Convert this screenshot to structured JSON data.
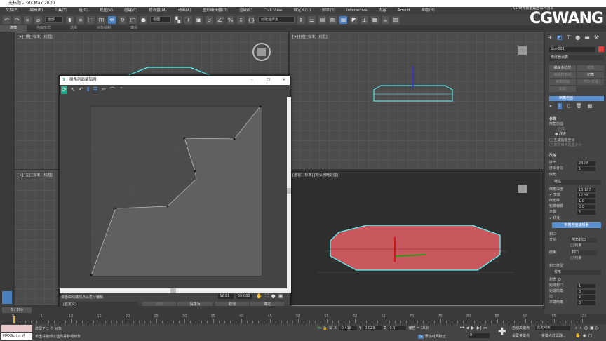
{
  "app": {
    "title": "无标题 - 3ds Max 2020"
  },
  "menu": [
    "文件(F)",
    "编辑(E)",
    "工具(T)",
    "组(G)",
    "视图(V)",
    "创建(C)",
    "修改器(M)",
    "动画(A)",
    "图形编辑器(D)",
    "渲染(R)",
    "Civil View",
    "自定义(U)",
    "脚本(S)",
    "Interactive",
    "内容",
    "Arnold",
    "帮助(H)"
  ],
  "toolbar": {
    "selection_filter": "全部",
    "ref_coord": "视图",
    "named_selection": "创建选择集"
  },
  "ribbon": [
    "建模",
    "自由形式",
    "选择",
    "对象绘制",
    "填充"
  ],
  "watermark": "CGWANG",
  "watermark_sub": "CG世界数据集团以人为本",
  "viewports": {
    "top": "[+] [顶] [标准] [线框]",
    "front": "[+] [前] [标准] [线框]",
    "left": "[+] [左] [标准] [线框]",
    "persp": "[透视] [标准] [默认明暗处理]"
  },
  "command_panel": {
    "object_name": "Star001",
    "modifier_list": "修改器列表",
    "buttons": [
      "编辑多边形",
      "倒角",
      "编辑样条线",
      "切角",
      "倒角剖面",
      "FFD 选择",
      "车削"
    ],
    "stack_item": "倒角剖面",
    "params_title": "参数",
    "bevel_profile": "倒角剖面",
    "classic": "经典",
    "improved": "改进",
    "gen_map": "生成贴图坐标",
    "real_world": "真实世界贴图大小",
    "improved_title": "改进",
    "extrude": "挤出",
    "extrude_val": "23.06",
    "extrude_seg": "挤出分段",
    "extrude_seg_val": "1",
    "bevel": "倒角",
    "bevel_type": "线性",
    "bevel_depth": "倒角深度",
    "bevel_depth_val": "13.187",
    "width": "宽度",
    "width_val": "17.56",
    "bevel_push": "倒角推",
    "bevel_push_val": "1.0",
    "contour_offset": "轮廓偏移",
    "contour_offset_val": "0.0",
    "steps": "步数",
    "steps_val": "5",
    "optimize": "优化",
    "profile_editor": "倒角剖面编辑器",
    "cap": "封口",
    "start": "开始",
    "start_val": "倒角封口",
    "flip1": "约束",
    "end": "结束",
    "end_val": "封口",
    "flip2": "约束",
    "cap_type": "封口类型",
    "cap_type_val": "变形",
    "material_ids": "材质 ID",
    "cap_front": "始端封口",
    "cap_front_val": "1",
    "bevel_id": "始端倒角",
    "bevel_id_val": "3",
    "sides": "边",
    "sides_val": "2",
    "end_bevel": "末端倒角",
    "end_bevel_val": "3"
  },
  "dialog": {
    "title": "倒角剖面编辑器",
    "status_msg": "单击曲线或顶点以进行编辑",
    "coord_x": "62.91",
    "coord_y": "55.082",
    "preset": "(自定义)",
    "save": "保存",
    "save_as": "另存为",
    "cancel": "取消",
    "ok": "确定"
  },
  "frame_slider": "0 / 100",
  "timeline_ticks": [
    "0",
    "5",
    "10",
    "15",
    "20",
    "25",
    "30",
    "35",
    "40",
    "45",
    "50",
    "55",
    "60",
    "65",
    "70",
    "75",
    "80",
    "85",
    "90",
    "95",
    "100"
  ],
  "status": {
    "selected": "选择了 1 个 对象",
    "hint": "单击并拖动以选择并移动对象",
    "maxscript": "MAXScript 迷",
    "x": "-0.418",
    "y": "0.023",
    "z": "0.0",
    "grid": "栅格 = 10.0",
    "add_time_tag": "添加时间标记",
    "frame": "0",
    "auto_key": "自动关键点",
    "set_key": "设置关键点",
    "selected_obj": "选定对象",
    "key_filters": "关键点过滤器..."
  }
}
